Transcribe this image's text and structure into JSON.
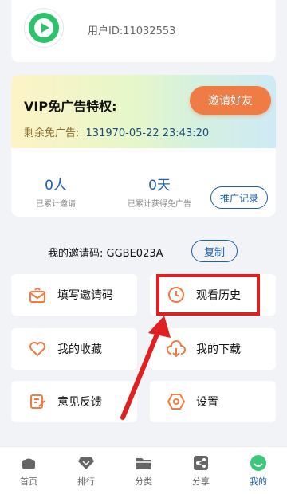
{
  "profile": {
    "user_id": "用户ID:11032553",
    "avatar_icon": "play-logo-icon"
  },
  "vip": {
    "title": "VIP免广告特权:",
    "invite_button": "邀请好友",
    "remaining_label": "剩余免广告:",
    "remaining_value": "131970-05-22 23:43:20",
    "stats": [
      {
        "value": "0人",
        "label": "已累计邀请"
      },
      {
        "value": "0天",
        "label": "已累计获得免广告"
      }
    ],
    "promo_record_button": "推广记录"
  },
  "invite_code": {
    "label": "我的邀请码: GGBE023A",
    "copy_button": "复制"
  },
  "menu": [
    {
      "label": "填写邀请码",
      "icon": "envelope-icon"
    },
    {
      "label": "观看历史",
      "icon": "clock-icon"
    },
    {
      "label": "我的收藏",
      "icon": "heart-icon"
    },
    {
      "label": "我的下载",
      "icon": "cloud-download-icon"
    },
    {
      "label": "意见反馈",
      "icon": "edit-icon"
    },
    {
      "label": "设置",
      "icon": "hexagon-settings-icon"
    }
  ],
  "tabs": [
    {
      "label": "首页",
      "icon": "home-icon"
    },
    {
      "label": "排行",
      "icon": "diamond-icon"
    },
    {
      "label": "分类",
      "icon": "folder-icon"
    },
    {
      "label": "分享",
      "icon": "share-icon"
    },
    {
      "label": "我的",
      "icon": "profile-icon",
      "active": true
    }
  ],
  "colors": {
    "accent": "#1e5fa8",
    "orange": "#ef7b45",
    "highlight": "#e02020",
    "active_tab": "#3cc87a"
  }
}
